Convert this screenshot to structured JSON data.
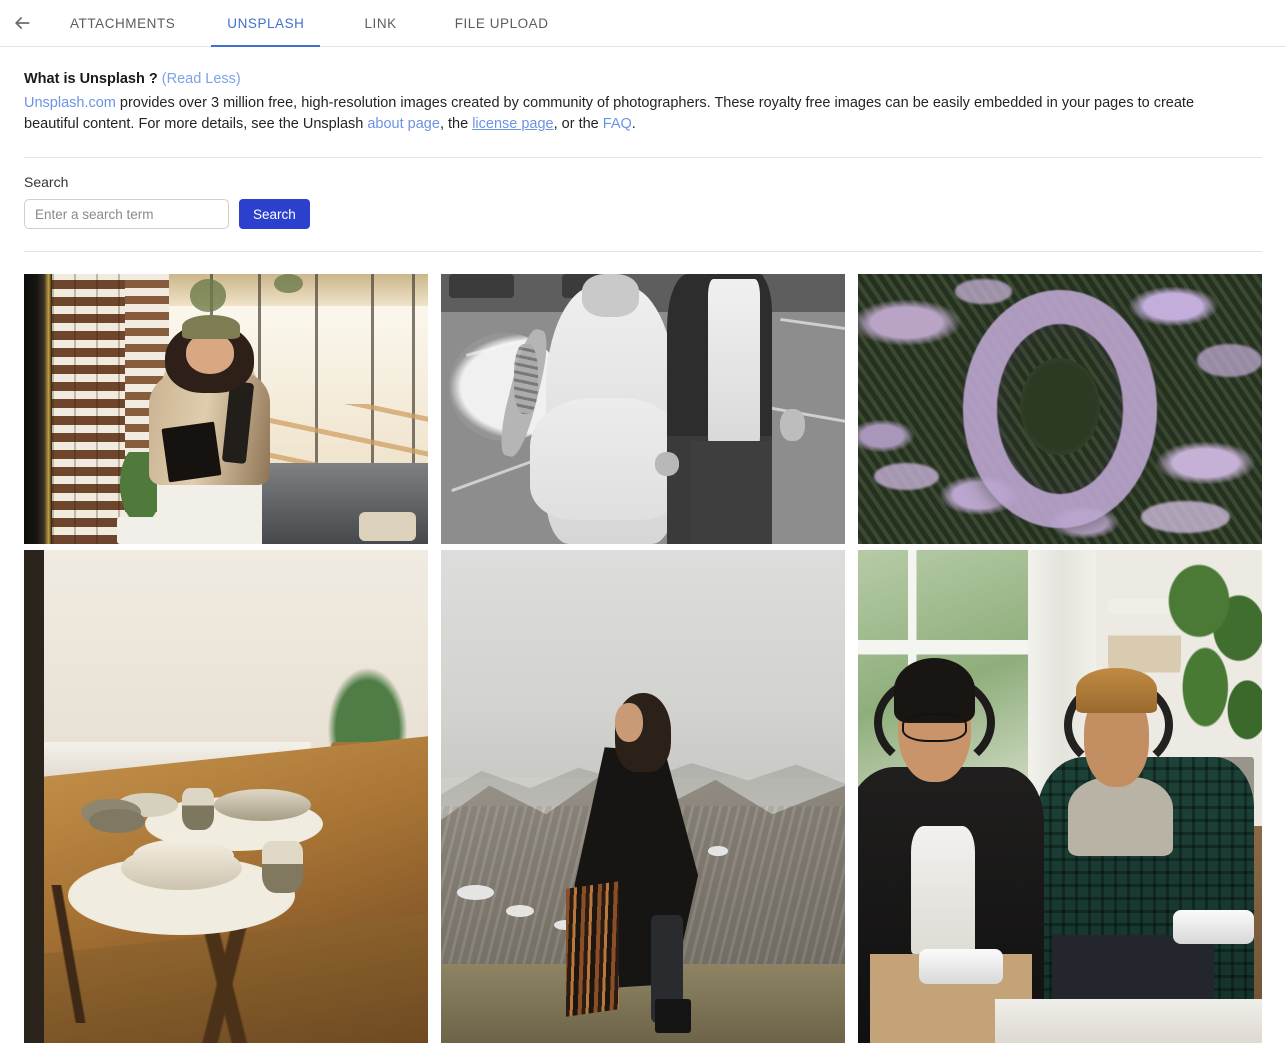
{
  "header": {
    "back_icon": "arrow-left-icon",
    "tabs": [
      {
        "id": "attachments",
        "label": "ATTACHMENTS",
        "active": false
      },
      {
        "id": "unsplash",
        "label": "UNSPLASH",
        "active": true
      },
      {
        "id": "link",
        "label": "LINK",
        "active": false
      },
      {
        "id": "fileupload",
        "label": "FILE UPLOAD",
        "active": false
      }
    ],
    "active_tab_color": "#4271cc",
    "inactive_tab_color": "#5d5d5d"
  },
  "intro": {
    "title": "What is Unsplash ?",
    "toggle_label": "(Read Less)",
    "site_link": "Unsplash.com",
    "body_part1": " provides over 3 million free, high-resolution images created by community of photographers. These royalty free images can be easily embedded in your pages to create beautiful content. For more details, see the Unsplash ",
    "about_link": "about page",
    "body_part2": ", the ",
    "license_link": "license page",
    "body_part3": ", or the ",
    "faq_link": "FAQ",
    "body_part4": ".",
    "link_color": "#6b93e6"
  },
  "search": {
    "label": "Search",
    "placeholder": "Enter a search term",
    "value": "",
    "button_label": "Search",
    "button_color": "#2b41cd"
  },
  "gallery": {
    "columns": 3,
    "images": [
      {
        "id": "img-1",
        "alt": "Smiling woman in beanie and tan coat walking through a sunlit cafe",
        "row": 1
      },
      {
        "id": "img-2",
        "alt": "Black and white photo of a bride in a tulle dress holding hands with a groom in a parking lot",
        "row": 1
      },
      {
        "id": "img-3",
        "alt": "Lavender wreath resting on a bed of purple statice flowers",
        "row": 1
      },
      {
        "id": "img-4",
        "alt": "Ceramic bowls, plates and cups on woven placemats on a wooden dining table",
        "row": 2
      },
      {
        "id": "img-5",
        "alt": "Woman wrapped in a black patterned blanket standing on a misty mountain ridge",
        "row": 2
      },
      {
        "id": "img-6",
        "alt": "Two smiling men wearing headphones playing video games with controllers",
        "row": 2
      }
    ]
  }
}
